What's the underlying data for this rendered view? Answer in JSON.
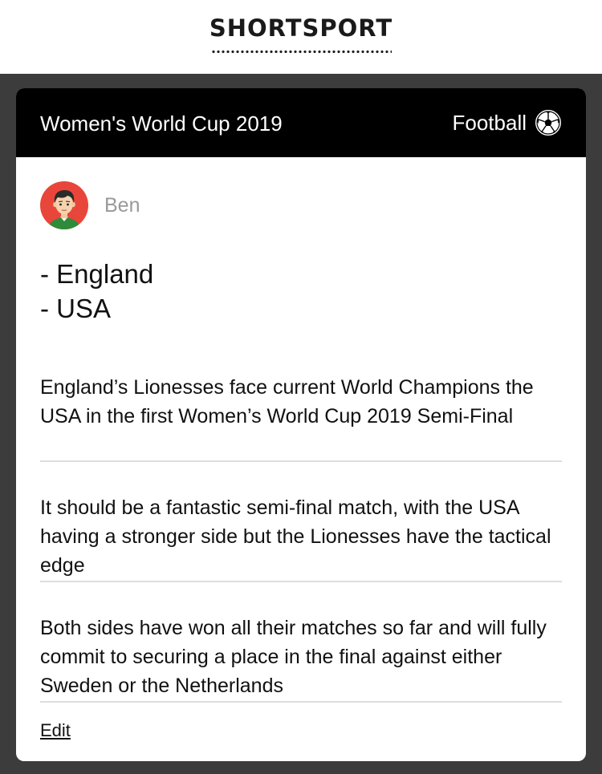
{
  "site": {
    "logo_bold_1": "SHORT",
    "logo_bold_2": "SPORT"
  },
  "card": {
    "title": "Women's World Cup 2019",
    "sport_label": "Football",
    "sport_icon": "football-icon",
    "author": {
      "name": "Ben",
      "avatar_icon": "avatar"
    },
    "teams": [
      "- England",
      "- USA"
    ],
    "paragraphs": [
      "England’s Lionesses face current World Champions the USA in the first Women’s World Cup 2019 Semi-Final",
      "It should be a fantastic semi-final match, with the USA having a stronger side but the Lionesses have the tactical edge",
      "Both sides have won all their matches so far and will fully commit to securing a place in the final against either Sweden or the Netherlands"
    ],
    "edit_label": "Edit"
  },
  "colors": {
    "header_bg": "#000000",
    "page_bg": "#3c3c3c",
    "card_bg": "#ffffff",
    "muted_text": "#999999"
  }
}
